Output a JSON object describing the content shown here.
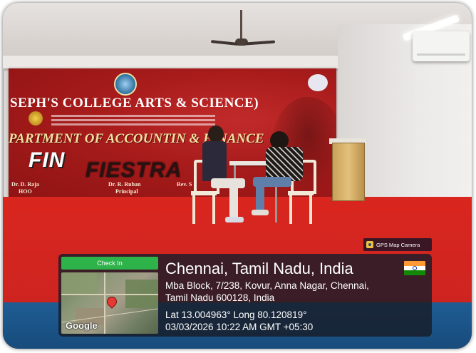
{
  "banner": {
    "college": "SEPH'S COLLEGE ARTS & SCIENCE)",
    "department": "PARTMENT OF ACCOUNTIN & FINANCE",
    "event_word1": "FIN",
    "event_word2": "FIESTRA",
    "names": [
      {
        "name": "Dr. D. Raja",
        "role": "HOO"
      },
      {
        "name": "Dr. R. Ruban",
        "role": "Principal"
      },
      {
        "name": "Rev. S",
        "role": ""
      }
    ]
  },
  "watermark": {
    "label": "GPS Map Camera",
    "icon": "camera-icon"
  },
  "overlay": {
    "checkin_label": "Check In",
    "map_brand": "Google",
    "location_title": "Chennai, Tamil Nadu, India",
    "flag": "india-flag",
    "address_line1": "Mba Block, 7/238, Kovur, Anna Nagar, Chennai,",
    "address_line2": "Tamil Nadu 600128, India",
    "coordinates": "Lat 13.004963° Long 80.120819°",
    "timestamp": "03/03/2026 10:22 AM GMT +05:30"
  },
  "colors": {
    "banner_red": "#a71b1b",
    "carpet_red": "#d22520",
    "checkin_green": "#2eb24a",
    "overlay_bg": "#191c28"
  }
}
